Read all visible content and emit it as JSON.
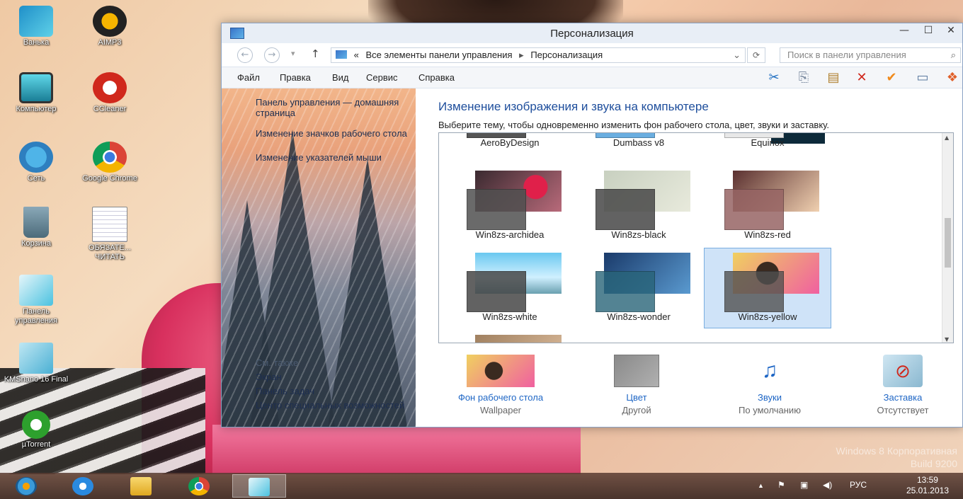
{
  "desktop": {
    "icons": [
      {
        "label": "Ванька"
      },
      {
        "label": "AIMP3"
      },
      {
        "label": "Компьютер"
      },
      {
        "label": "CCleaner"
      },
      {
        "label": "Сеть"
      },
      {
        "label": "Google Chrome"
      },
      {
        "label": "Корзина"
      },
      {
        "label": "ОБЯЗАТЕ... ЧИТАТЬ"
      },
      {
        "label": "Панель управления"
      },
      {
        "label": "KMSnano 16 Final"
      },
      {
        "label": "µTorrent"
      }
    ],
    "watermark_line1": "Windows 8 Корпоративная",
    "watermark_line2": "Build 9200"
  },
  "window": {
    "title": "Персонализация",
    "controls": {
      "minimize": "—",
      "maximize": "☐",
      "close": "✕"
    },
    "address": {
      "prefix": "«",
      "crumb1": "Все элементы панели управления",
      "sep": "▸",
      "crumb2": "Персонализация",
      "dropdown": "⌄",
      "refresh": "⟳"
    },
    "search_placeholder": "Поиск в панели управления",
    "menu": [
      "Файл",
      "Правка",
      "Вид",
      "Сервис",
      "Справка"
    ],
    "left_links": {
      "home": "Панель управления — домашняя страница",
      "desktop_icons": "Изменение значков рабочего стола",
      "mouse_pointers": "Изменение указателей мыши",
      "see_also": "См. также",
      "display": "Экран",
      "taskbar": "Панель задач",
      "ease": "Центр специальных возможностей"
    },
    "heading": "Изменение изображения и звука на компьютере",
    "subheading": "Выберите тему, чтобы одновременно изменить фон рабочего стола, цвет, звуки и заставку.",
    "themes_row0": [
      {
        "name": "AeroByDesign"
      },
      {
        "name": "Dumbass v8"
      },
      {
        "name": "Equinox"
      }
    ],
    "themes": [
      {
        "name": "Win8zs-archidea",
        "selected": false
      },
      {
        "name": "Win8zs-black",
        "selected": false
      },
      {
        "name": "Win8zs-red",
        "selected": false
      },
      {
        "name": "Win8zs-white",
        "selected": false
      },
      {
        "name": "Win8zs-wonder",
        "selected": false
      },
      {
        "name": "Win8zs-yellow",
        "selected": true
      }
    ],
    "bottom": [
      {
        "label": "Фон рабочего стола",
        "value": "Wallpaper"
      },
      {
        "label": "Цвет",
        "value": "Другой"
      },
      {
        "label": "Звуки",
        "value": "По умолчанию"
      },
      {
        "label": "Заставка",
        "value": "Отсутствует"
      }
    ]
  },
  "taskbar": {
    "lang": "РУС",
    "time": "13:59",
    "date": "25.01.2013",
    "tray_up": "▲"
  },
  "colors": {
    "link": "#1e66c5",
    "heading": "#1e4e9c",
    "selection": "#cfe3f8"
  }
}
